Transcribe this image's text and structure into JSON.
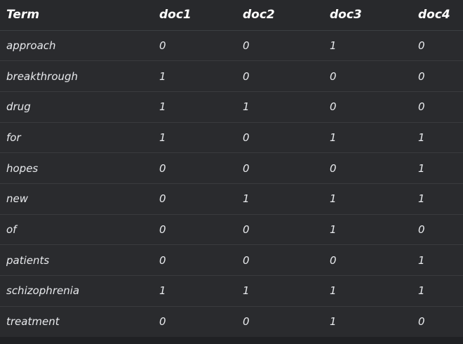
{
  "table": {
    "headers": [
      "Term",
      "doc1",
      "doc2",
      "doc3",
      "doc4"
    ],
    "rows": [
      [
        "approach",
        "0",
        "0",
        "1",
        "0"
      ],
      [
        "breakthrough",
        "1",
        "0",
        "0",
        "0"
      ],
      [
        "drug",
        "1",
        "1",
        "0",
        "0"
      ],
      [
        "for",
        "1",
        "0",
        "1",
        "1"
      ],
      [
        "hopes",
        "0",
        "0",
        "0",
        "1"
      ],
      [
        "new",
        "0",
        "1",
        "1",
        "1"
      ],
      [
        "of",
        "0",
        "0",
        "1",
        "0"
      ],
      [
        "patients",
        "0",
        "0",
        "0",
        "1"
      ],
      [
        "schizophrenia",
        "1",
        "1",
        "1",
        "1"
      ],
      [
        "treatment",
        "0",
        "0",
        "1",
        "0"
      ]
    ]
  }
}
